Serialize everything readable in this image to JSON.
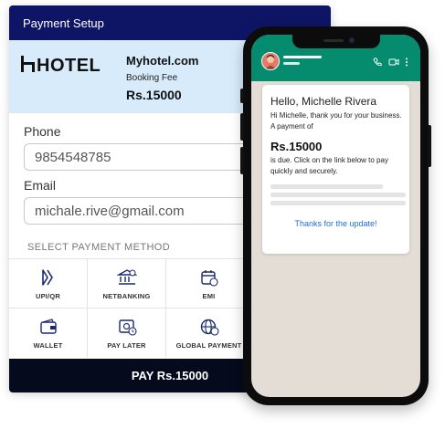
{
  "payment": {
    "header_title": "Payment Setup",
    "merchant": {
      "logo_text": "HOTEL",
      "site": "Myhotel.com",
      "fee_label": "Booking Fee",
      "amount": "Rs.15000"
    },
    "phone_label": "Phone",
    "phone_value": "9854548785",
    "email_label": "Email",
    "email_value": "michale.rive@gmail.com",
    "select_title": "SELECT PAYMENT METHOD",
    "methods": [
      {
        "label": "UPI/QR",
        "icon": "upi-icon"
      },
      {
        "label": "NETBANKING",
        "icon": "bank-icon"
      },
      {
        "label": "EMI",
        "icon": "calendar-icon"
      },
      {
        "label": "WALLET",
        "icon": "wallet-icon"
      },
      {
        "label": "PAY LATER",
        "icon": "pay-later-icon"
      },
      {
        "label": "GLOBAL PAYMENT",
        "icon": "globe-icon"
      }
    ],
    "pay_button": "PAY Rs.15000",
    "colors": {
      "header": "#0f1565",
      "merchant_bg": "#d7ebfb",
      "pay_button": "#050a1c"
    }
  },
  "phone": {
    "appbar_color": "#058c6f",
    "icons": [
      "phone-call-icon",
      "video-call-icon",
      "more-vert-icon"
    ],
    "message": {
      "greeting": "Hello, Michelle Rivera",
      "line1": "Hi Michelle, thank you for your business. A payment of",
      "amount": "Rs.15000",
      "line2": "is due. Click on the link below to pay quickly and securely.",
      "action": "Thanks for the update!"
    }
  }
}
